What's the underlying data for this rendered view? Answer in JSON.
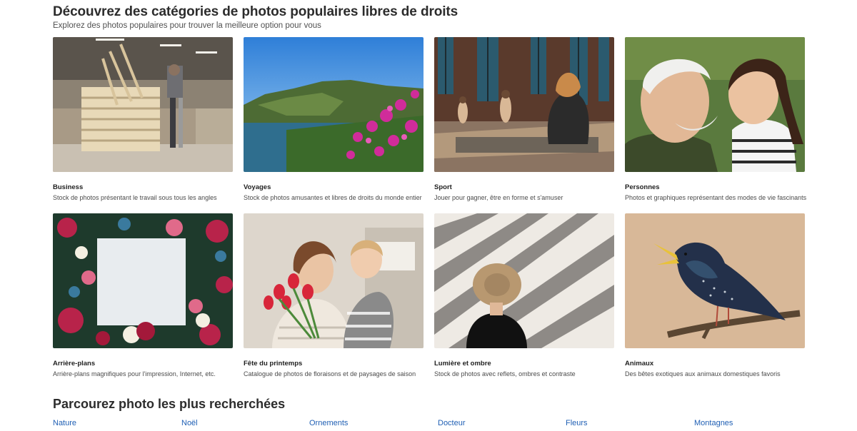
{
  "header": {
    "title": "Découvrez des catégories de photos populaires libres de droits",
    "subtitle": "Explorez des photos populaires pour trouver la meilleure option pour vous"
  },
  "categories": [
    {
      "name": "Business",
      "desc": "Stock de photos présentant le travail sous tous les angles"
    },
    {
      "name": "Voyages",
      "desc": "Stock de photos amusantes et libres de droits du monde entier"
    },
    {
      "name": "Sport",
      "desc": "Jouer pour gagner, être en forme et s'amuser"
    },
    {
      "name": "Personnes",
      "desc": "Photos et graphiques représentant des modes de vie fascinants"
    },
    {
      "name": "Arrière-plans",
      "desc": "Arrière-plans magnifiques pour l'impression, Internet, etc."
    },
    {
      "name": "Fête du printemps",
      "desc": "Catalogue de photos de floraisons et de paysages de saison"
    },
    {
      "name": "Lumière et ombre",
      "desc": "Stock de photos avec reflets, ombres et contraste"
    },
    {
      "name": "Animaux",
      "desc": "Des bêtes exotiques aux animaux domestiques favoris"
    }
  ],
  "popular": {
    "title": "Parcourez photo les plus recherchées",
    "links": [
      "Nature",
      "Noël",
      "Ornements",
      "Docteur",
      "Fleurs",
      "Montagnes"
    ]
  },
  "colors": {
    "link": "#1f5fb4",
    "title": "#2c2c2c"
  }
}
